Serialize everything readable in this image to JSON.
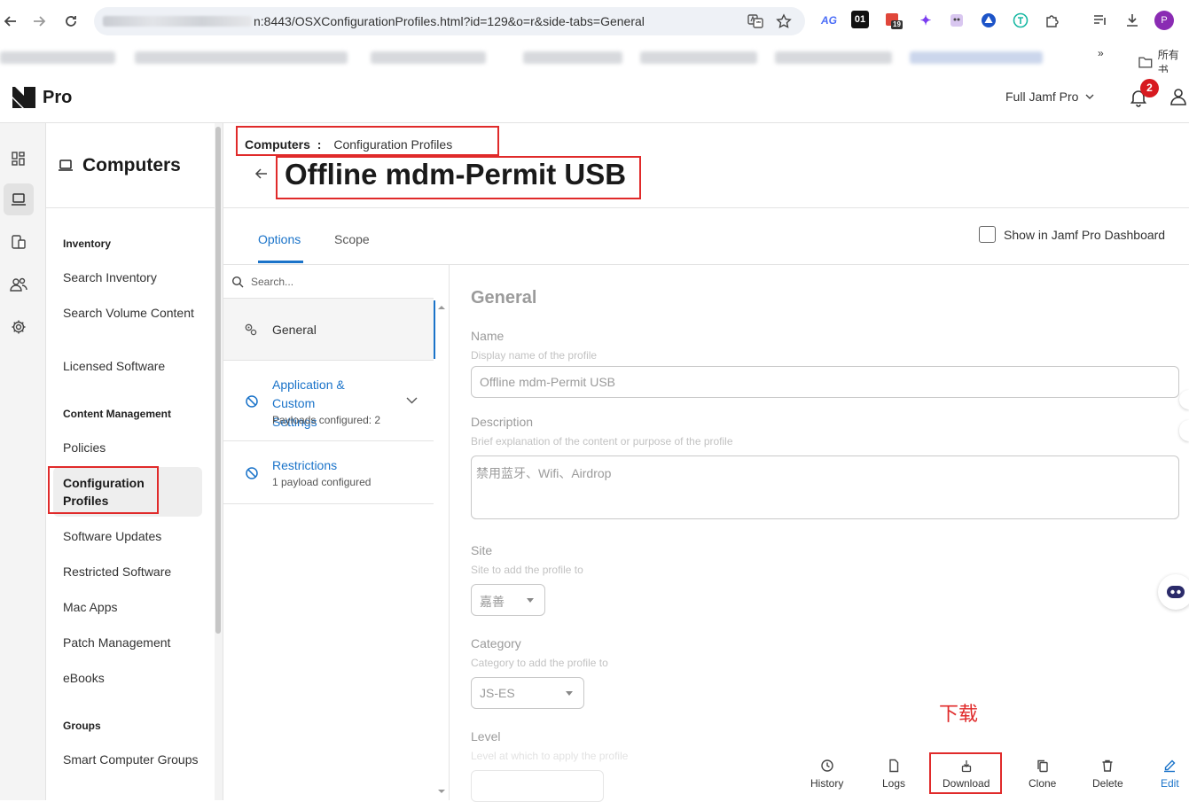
{
  "browser": {
    "url": "n:8443/OSXConfigurationProfiles.html?id=129&o=r&side-tabs=General",
    "bookmarks_folder_label": "所有书",
    "calendar_ext_badge": "19",
    "ext_01_label": "01",
    "avatar_letter": "P"
  },
  "header": {
    "logo_text": "Pro",
    "environment": "Full Jamf Pro",
    "notification_count": "2"
  },
  "sidenav": {
    "title": "Computers",
    "sections": [
      {
        "heading": "Inventory",
        "items": [
          "Search Inventory",
          "Search Volume Content",
          "Licensed Software"
        ]
      },
      {
        "heading": "Content Management",
        "items": [
          "Policies",
          "Configuration Profiles",
          "Software Updates",
          "Restricted Software",
          "Mac Apps",
          "Patch Management",
          "eBooks"
        ]
      },
      {
        "heading": "Groups",
        "items": [
          "Smart Computer Groups"
        ]
      }
    ]
  },
  "breadcrumb": {
    "section": "Computers",
    "separator": ":",
    "page": "Configuration Profiles"
  },
  "page_title": "Offline mdm-Permit USB",
  "tabs": [
    {
      "label": "Options",
      "active": true
    },
    {
      "label": "Scope",
      "active": false
    }
  ],
  "dashboard_toggle": {
    "label": "Show in Jamf Pro Dashboard",
    "checked": false
  },
  "payloads": {
    "search_placeholder": "Search...",
    "items": [
      {
        "label": "General",
        "sub": ""
      },
      {
        "label": "Application & Custom Settings",
        "sub": "Payloads configured: 2"
      },
      {
        "label": "Restrictions",
        "sub": "1 payload configured"
      }
    ]
  },
  "general": {
    "heading": "General",
    "name_label": "Name",
    "name_help": "Display name of the profile",
    "name_value": "Offline mdm-Permit USB",
    "description_label": "Description",
    "description_help": "Brief explanation of the content or purpose of the profile",
    "description_value": "禁用蓝牙、Wifi、Airdrop",
    "site_label": "Site",
    "site_help": "Site to add the profile to",
    "site_value": "嘉善",
    "category_label": "Category",
    "category_help": "Category to add the profile to",
    "category_value": "JS-ES",
    "level_label": "Level",
    "level_help": "Level at which to apply the profile"
  },
  "annotation_text": "下载",
  "actions": [
    "History",
    "Logs",
    "Download",
    "Clone",
    "Delete",
    "Edit"
  ],
  "colors": {
    "accent": "#1a73c9",
    "highlight": "#e02a2a",
    "badge": "#d71a20"
  }
}
